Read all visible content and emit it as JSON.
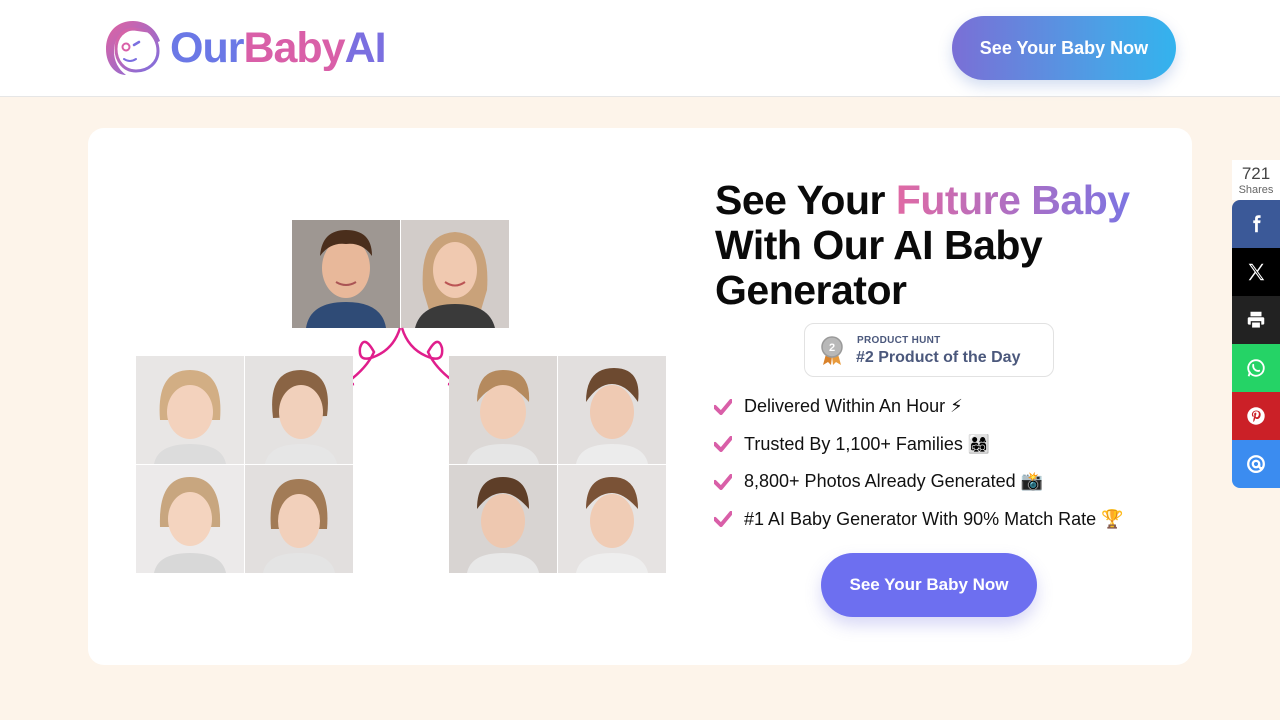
{
  "header": {
    "logo": {
      "part1": "Our",
      "part2": "Baby",
      "part3": "AI"
    },
    "cta_label": "See Your Baby Now"
  },
  "hero": {
    "title_part1": "See Your ",
    "title_highlight": "Future Baby",
    "title_part2": "With Our AI Baby Generator",
    "product_hunt": {
      "label": "PRODUCT HUNT",
      "title": "#2 Product of the Day",
      "rank": "2"
    },
    "features": [
      "Delivered Within An Hour ⚡",
      "Trusted By 1,100+ Families 👨‍👩‍👧‍👦",
      "8,800+ Photos Already Generated 📸",
      "#1 AI Baby Generator With 90% Match Rate 🏆"
    ],
    "cta_label": "See Your Baby Now"
  },
  "share": {
    "count": "721",
    "count_label": "Shares",
    "buttons": [
      "facebook-icon",
      "x-icon",
      "print-icon",
      "whatsapp-icon",
      "pinterest-icon",
      "email-icon"
    ]
  },
  "colors": {
    "accent_pink": "#d95fa8",
    "accent_purple": "#6b78e6",
    "cta": "#6d6ff0",
    "background": "#fdf4ea"
  }
}
